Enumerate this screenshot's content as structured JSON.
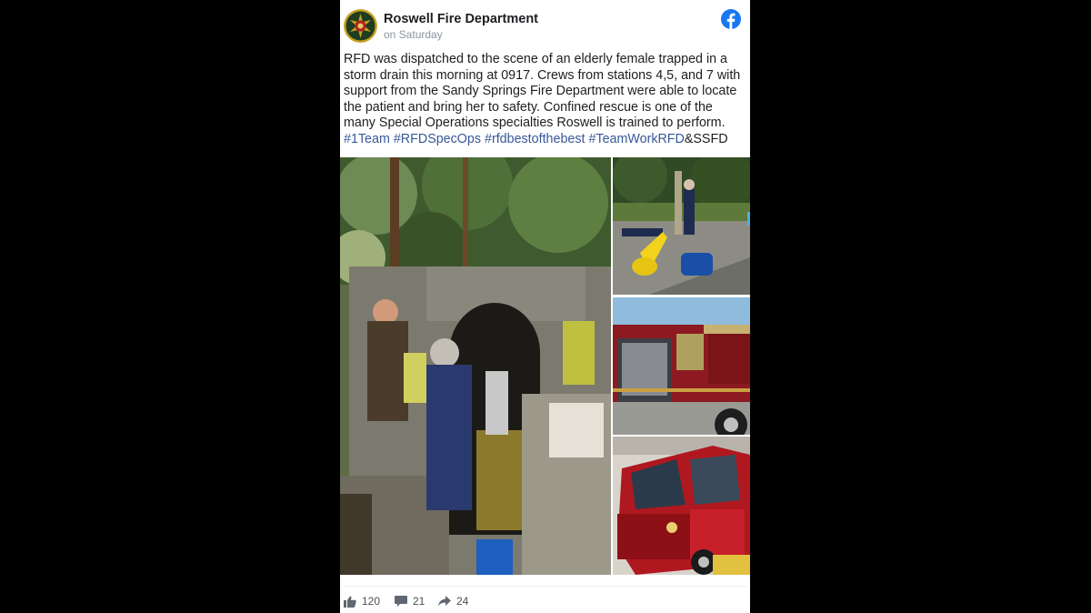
{
  "post": {
    "page_name": "Roswell Fire Department",
    "time": "on Saturday",
    "text_body": "RFD was dispatched to the scene of an elderly female trapped in a storm drain this morning at 0917. Crews from stations 4,5, and 7 with support from the Sandy Springs Fire Department were able to locate the patient and bring her to safety. Confined rescue is one of the many Special Operations specialties Roswell is trained to perform. ",
    "hashtags": [
      "#1Team",
      "#RFDSpecOps",
      "#rfdbestofthebest",
      "#TeamWorkRFD"
    ],
    "text_suffix": "&SSFD"
  },
  "icons": {
    "avatar": "fire-department-logo",
    "brand": "facebook-icon",
    "like": "thumbs-up-icon",
    "comment": "comment-icon",
    "share": "share-icon"
  },
  "colors": {
    "facebook_blue": "#1877f2",
    "hashtag": "#385898",
    "background": "#000000",
    "card": "#ffffff"
  },
  "stats": {
    "likes": "120",
    "comments": "21",
    "shares": "24"
  }
}
